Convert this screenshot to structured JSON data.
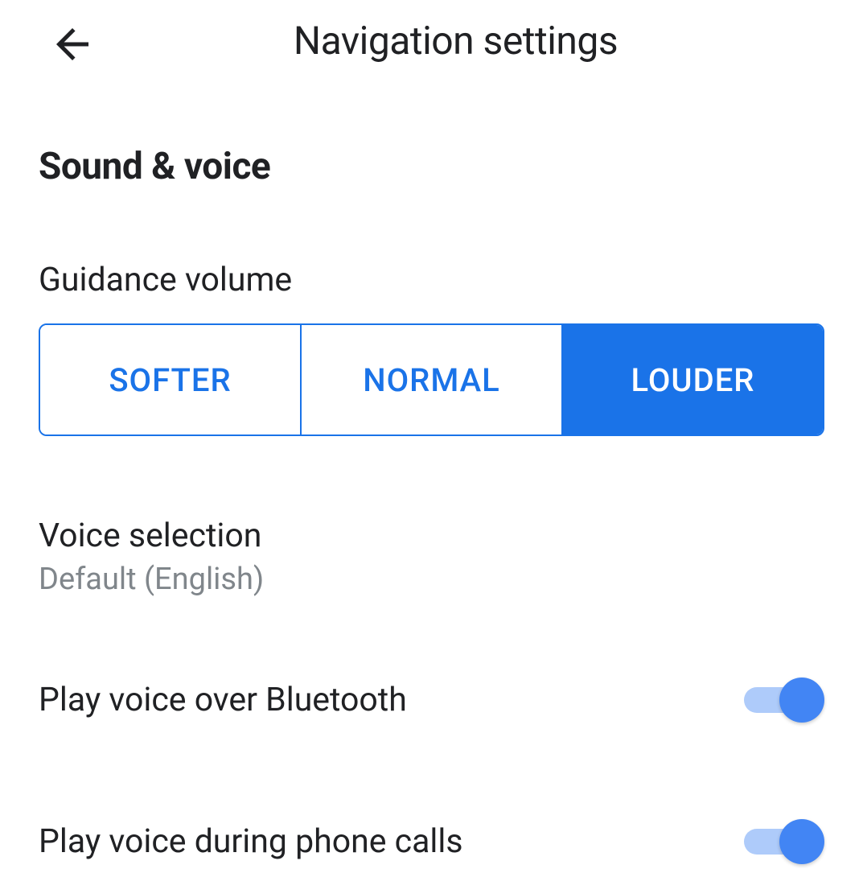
{
  "header": {
    "title": "Navigation settings"
  },
  "section": {
    "title": "Sound & voice"
  },
  "guidance": {
    "label": "Guidance volume",
    "options": {
      "softer": "SOFTER",
      "normal": "NORMAL",
      "louder": "LOUDER"
    },
    "selected": "louder"
  },
  "voiceSelection": {
    "title": "Voice selection",
    "subtitle": "Default (English)"
  },
  "toggles": {
    "bluetooth": {
      "label": "Play voice over Bluetooth",
      "enabled": true
    },
    "phoneCalls": {
      "label": "Play voice during phone calls",
      "enabled": true
    }
  }
}
